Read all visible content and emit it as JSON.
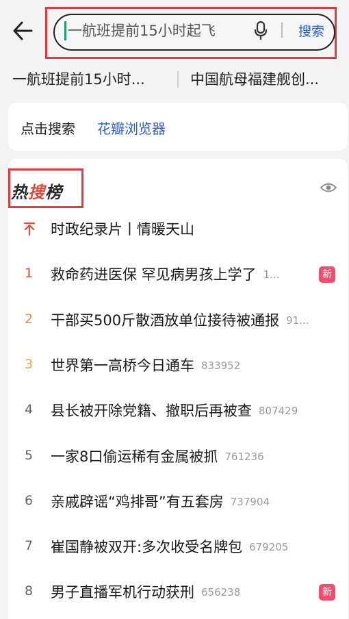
{
  "search": {
    "query": "一航班提前15小时起飞",
    "button_label": "搜索"
  },
  "suggestions": [
    "一航班提前15小时...",
    "中国航母福建舰创..."
  ],
  "prompt_card": {
    "lead": "点击搜索",
    "browser": "花瓣浏览器"
  },
  "hot_list": {
    "title_parts": [
      "热",
      "搜",
      "榜"
    ],
    "items": [
      {
        "rank": "",
        "title": "时政纪录片丨情暖天山",
        "count": "",
        "badge": "",
        "pinned": true
      },
      {
        "rank": "1",
        "title": "救命药进医保 罕见病男孩上学了",
        "count": "1...",
        "badge": "新"
      },
      {
        "rank": "2",
        "title": "干部买500斤散酒放单位接待被通报",
        "count": "91...",
        "badge": ""
      },
      {
        "rank": "3",
        "title": "世界第一高桥今日通车",
        "count": "833952",
        "badge": ""
      },
      {
        "rank": "4",
        "title": "县长被开除党籍、撤职后再被查",
        "count": "807429",
        "badge": ""
      },
      {
        "rank": "5",
        "title": "一家8口偷运稀有金属被抓",
        "count": "761236",
        "badge": ""
      },
      {
        "rank": "6",
        "title": "亲戚辟谣“鸡排哥”有五套房",
        "count": "737904",
        "badge": ""
      },
      {
        "rank": "7",
        "title": "崔国静被双开:多次收受名牌包",
        "count": "679205",
        "badge": ""
      },
      {
        "rank": "8",
        "title": "男子直播军机行动获刑",
        "count": "656238",
        "badge": "新"
      }
    ]
  },
  "colors": {
    "accent_blue": "#2a62c9",
    "rank_top": "#e24a3a",
    "rank_second": "#e98a3a",
    "rank_third": "#efa33a",
    "badge_new": "#f0506e",
    "highlight_red": "#e23b3b"
  }
}
